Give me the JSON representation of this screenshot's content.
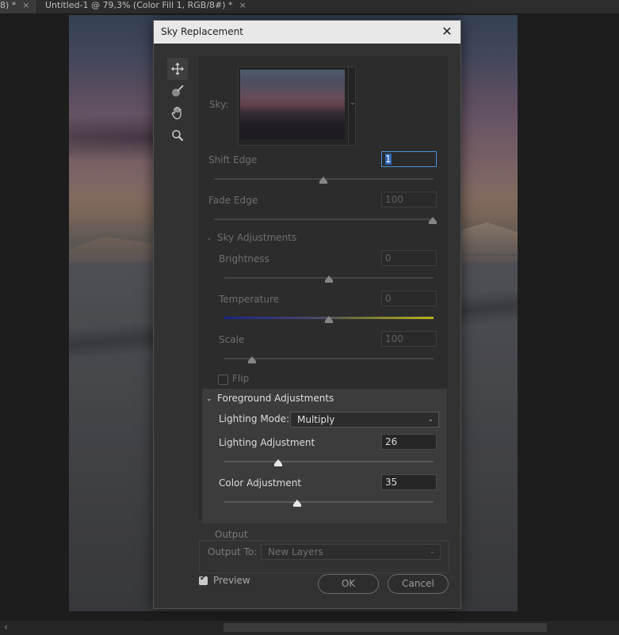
{
  "tabs": [
    {
      "label": "8) *",
      "close": "×"
    },
    {
      "label": "Untitled-1 @ 79,3% (Color Fill 1, RGB/8#) *",
      "close": "×"
    }
  ],
  "dialog": {
    "title": "Sky Replacement",
    "close_glyph": "✕",
    "tools": [
      "move-tool-icon",
      "sky-brush-icon",
      "hand-icon",
      "zoom-icon"
    ],
    "sky": {
      "label": "Sky:",
      "dropdown_glyph": "⌄"
    },
    "shift_edge": {
      "label": "Shift Edge",
      "value": "1",
      "slider": 0.5
    },
    "fade_edge": {
      "label": "Fade Edge",
      "value": "100",
      "slider": 1.0
    },
    "sky_adjustments": {
      "header": "Sky Adjustments",
      "brightness": {
        "label": "Brightness",
        "value": "0",
        "slider": 0.5
      },
      "temperature": {
        "label": "Temperature",
        "value": "0",
        "slider": 0.5
      },
      "scale": {
        "label": "Scale",
        "value": "100",
        "slider": 0.13
      },
      "flip": {
        "label": "Flip",
        "checked": false
      }
    },
    "foreground_adjustments": {
      "header": "Foreground Adjustments",
      "lighting_mode": {
        "label": "Lighting Mode:",
        "value": "Multiply"
      },
      "lighting_adjustment": {
        "label": "Lighting Adjustment",
        "value": "26",
        "slider": 0.26
      },
      "color_adjustment": {
        "label": "Color Adjustment",
        "value": "35",
        "slider": 0.35
      }
    },
    "output": {
      "section": "Output",
      "label": "Output To:",
      "value": "New Layers"
    },
    "preview": {
      "label": "Preview",
      "checked": true
    },
    "ok_label": "OK",
    "cancel_label": "Cancel"
  },
  "dropdown_glyph": "⌄",
  "scroll_left_glyph": "‹"
}
